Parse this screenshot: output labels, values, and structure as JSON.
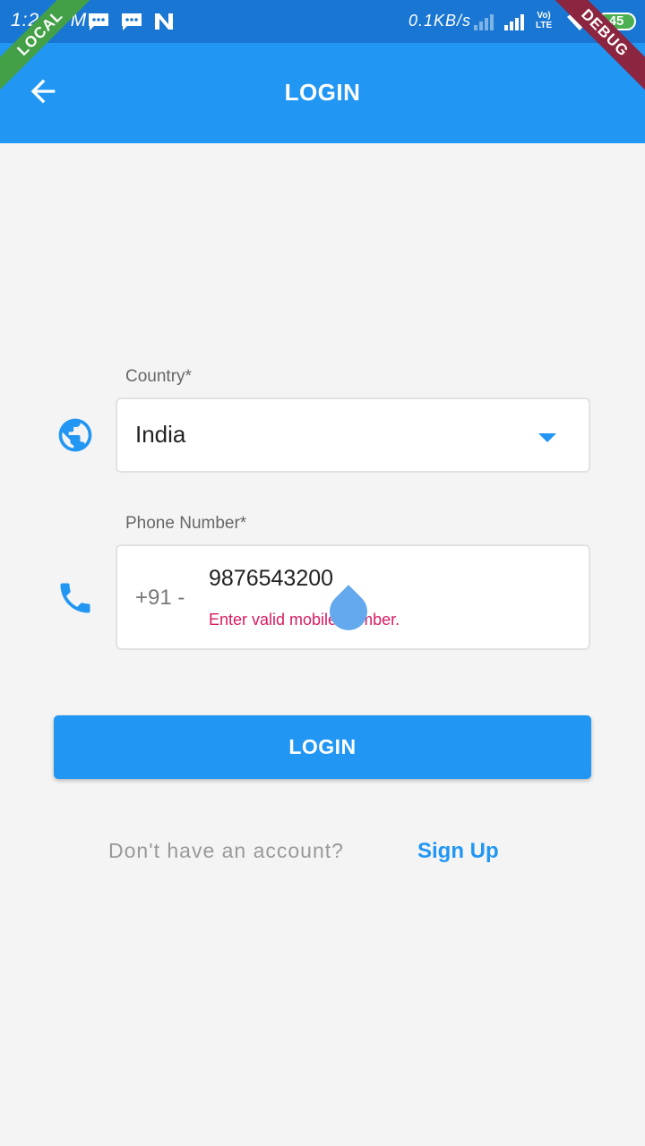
{
  "status_bar": {
    "time": "1:26 PM",
    "network_speed": "0.1KB/s",
    "volte_line1": "Vo)",
    "volte_line2": "LTE",
    "battery": "45",
    "notification_icons": [
      "message-icon",
      "message-icon",
      "n-app-icon"
    ]
  },
  "banners": {
    "left": "LOCAL",
    "right": "DEBUG"
  },
  "app_bar": {
    "title": "LOGIN",
    "back_icon": "arrow-back-icon"
  },
  "form": {
    "country": {
      "label": "Country*",
      "value": "India",
      "icon": "globe-icon"
    },
    "phone": {
      "label": "Phone Number*",
      "prefix": "+91 -",
      "value": "9876543200",
      "error": "Enter valid mobile number.",
      "icon": "phone-icon"
    },
    "login_button": "LOGIN"
  },
  "footer": {
    "prompt": "Don't have an account?",
    "signup_link": "Sign Up"
  },
  "colors": {
    "primary": "#2196f3",
    "status_bar": "#1976d2",
    "error": "#d81b60",
    "background": "#f4f4f4"
  }
}
